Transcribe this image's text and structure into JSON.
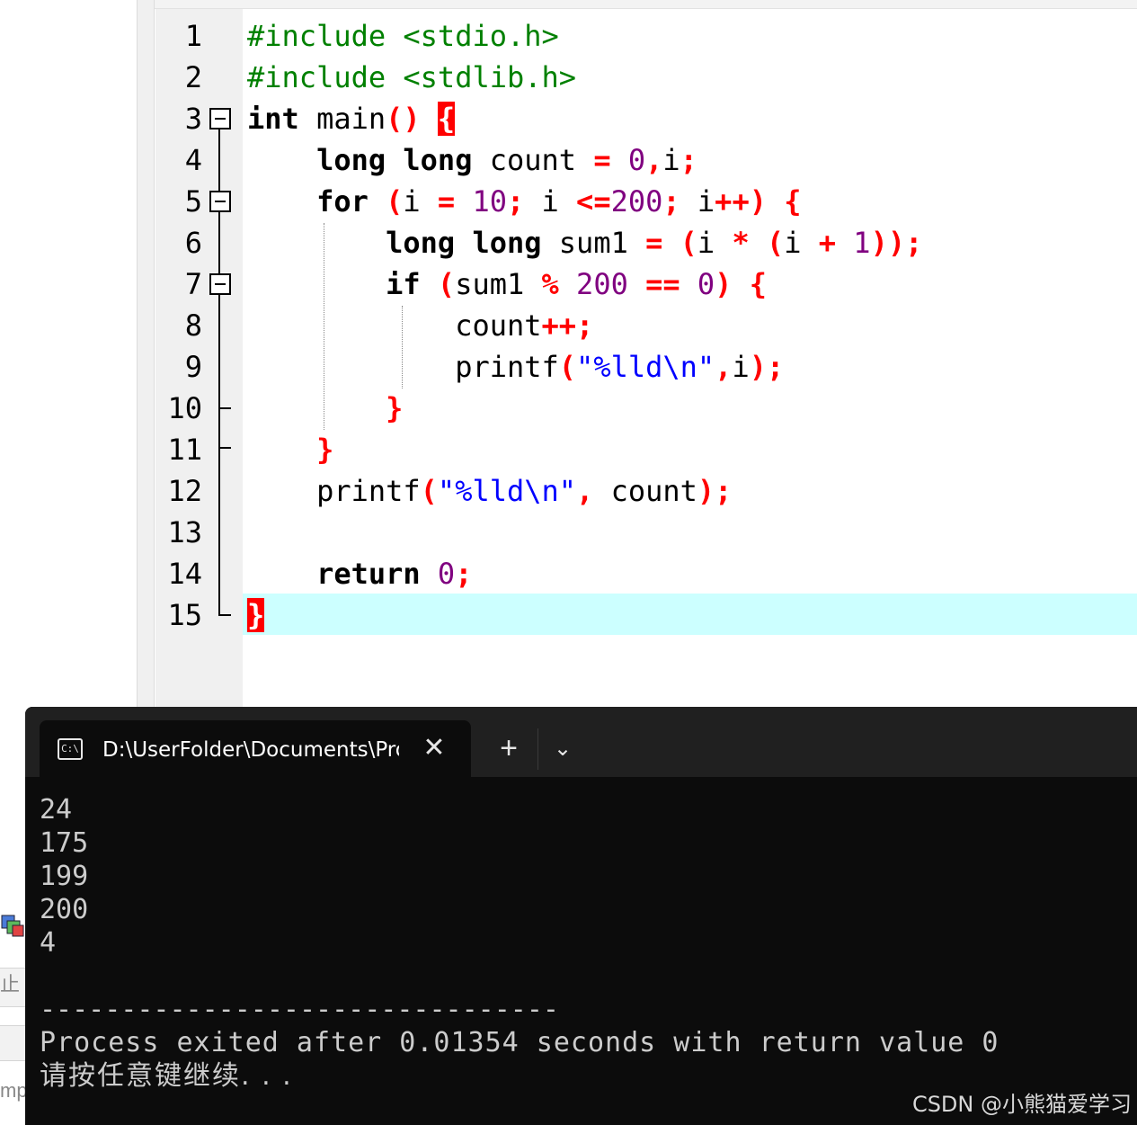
{
  "editor": {
    "line_numbers": [
      "1",
      "2",
      "3",
      "4",
      "5",
      "6",
      "7",
      "8",
      "9",
      "10",
      "11",
      "12",
      "13",
      "14",
      "15"
    ]
  },
  "terminal": {
    "tab_title": "D:\\UserFolder\\Documents\\Pro",
    "icon_text": "C:\\",
    "close_glyph": "✕",
    "new_tab_glyph": "+",
    "dropdown_glyph": "⌄",
    "output_lines": [
      "24",
      "175",
      "199",
      "200",
      "4"
    ],
    "separator": "--------------------------------",
    "process_message": "Process exited after 0.01354 seconds with return value 0",
    "press_key_message": "请按任意键继续. . ."
  },
  "left_panel": {
    "fragment_1": "止",
    "fragment_2": "mp"
  },
  "watermark": "CSDN @小熊猫爱学习",
  "colors": {
    "keyword": "#000000",
    "preprocessor": "#008000",
    "number": "#800080",
    "operator": "#ff0000",
    "string": "#0000ff",
    "current_line": "#ccffff",
    "terminal_bg": "#0c0c0c"
  }
}
